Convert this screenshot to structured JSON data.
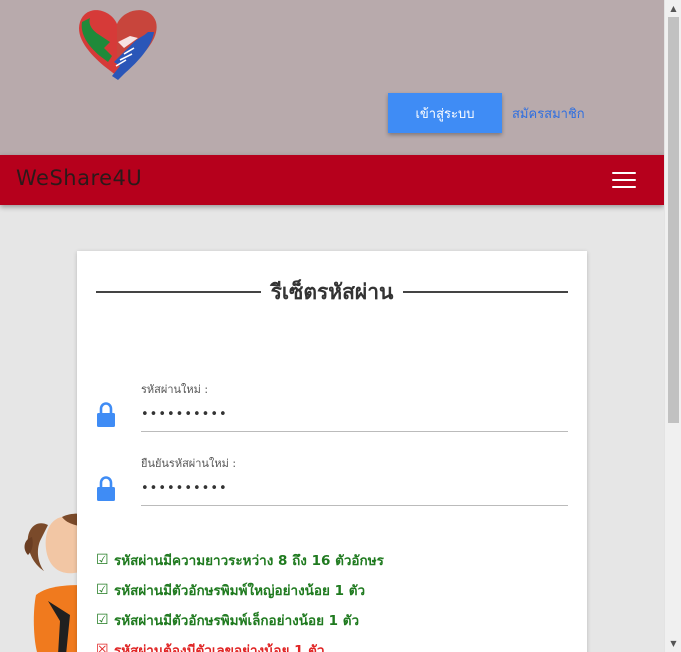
{
  "header": {
    "login_label": "เข้าสู่ระบบ",
    "register_label": "สมัครสมาชิก"
  },
  "navbar": {
    "brand": "WeShare4U"
  },
  "card": {
    "title": "รีเซ็ตรหัสผ่าน",
    "fields": [
      {
        "label": "รหัสผ่านใหม่ :",
        "value": "••••••••••"
      },
      {
        "label": "ยืนยันรหัสผ่านใหม่ :",
        "value": "••••••••••"
      }
    ],
    "rules": [
      {
        "mark": "☑",
        "text": "รหัสผ่านมีความยาวระหว่าง 8 ถึง 16 ตัวอักษร",
        "status": "ok"
      },
      {
        "mark": "☑",
        "text": "รหัสผ่านมีตัวอักษรพิมพ์ใหญ่อย่างน้อย 1 ตัว",
        "status": "ok"
      },
      {
        "mark": "☑",
        "text": "รหัสผ่านมีตัวอักษรพิมพ์เล็กอย่างน้อย 1 ตัว",
        "status": "ok"
      },
      {
        "mark": "☒",
        "text": "รหัสผ่านต้องมีตัวเลขอย่างน้อย 1 ตัว",
        "status": "bad"
      }
    ]
  },
  "colors": {
    "header_bg": "#b8aaac",
    "navbar_bg": "#b6001c",
    "button_bg": "#3f8cf5",
    "link": "#2f6fe0",
    "ok": "#1f7a1f",
    "bad": "#e02424"
  },
  "icons": {
    "logo": "heart-hands-logo",
    "field": "lock-icon",
    "menu": "hamburger-menu-icon"
  }
}
